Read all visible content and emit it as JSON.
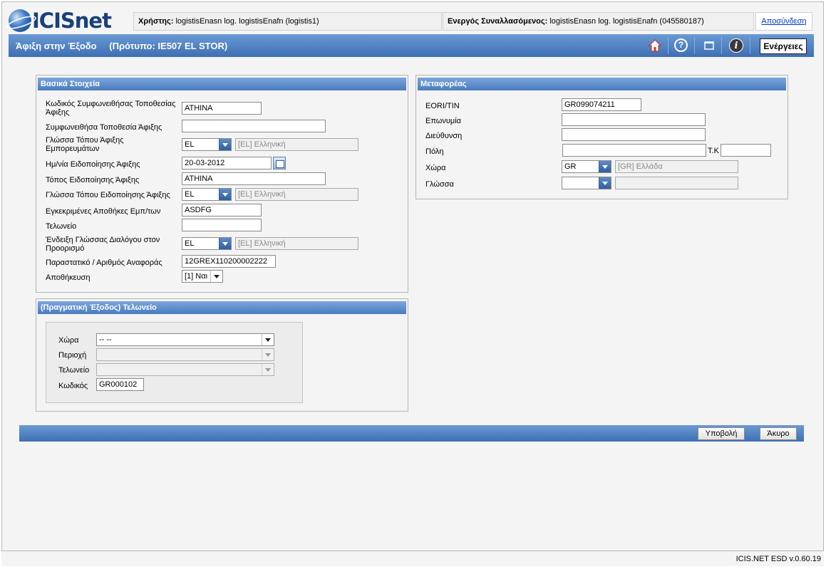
{
  "header": {
    "logo_text": "ICISnet",
    "user_label": "Χρήστης:",
    "user_value": "logistisEnasn log. logistisEnafn (logistis1)",
    "active_label": "Ενεργός Συναλλασόμενος:",
    "active_value": "logistisEnasn log. logistisEnafn (045580187)",
    "logout": "Αποσύνδεση"
  },
  "titlebar": {
    "title": "Άφιξη στην Έξοδο",
    "template": "(Πρότυπο: IE507 EL STOR)",
    "icons": [
      "home-icon",
      "help-icon",
      "window-icon",
      "info-icon"
    ],
    "actions_label": "Ενέργειες"
  },
  "basic": {
    "title": "Βασικά Στοιχεία",
    "agreed_code_label": "Κωδικός Συμφωνειθήσας Τοποθεσίας Άφιξης",
    "agreed_code_value": "ATHINA",
    "agreed_location_label": "Συμφωνειθήσα Τοποθεσία Άφιξης",
    "agreed_location_value": "",
    "goods_lang_label": "Γλώσσα Τόπου Άφιξης Εμπορευμάτων",
    "goods_lang_code": "EL",
    "goods_lang_desc": "[EL] Ελληνική",
    "notif_date_label": "Ημ/νία Ειδοποίησης Άφιξης",
    "notif_date_value": "20-03-2012",
    "notif_place_label": "Τόπος Ειδοποίησης Άφιξης",
    "notif_place_value": "ATHINA",
    "notif_lang_label": "Γλώσσα Τόπου Ειδοποίησης Άφιξης",
    "notif_lang_code": "EL",
    "notif_lang_desc": "[EL] Ελληνική",
    "warehouses_label": "Εγκεκριμένες Αποθήκες Εμπ/των",
    "warehouses_value": "ASDFG",
    "customs_label": "Τελωνείο",
    "customs_value": "",
    "dialog_lang_label": "Ένδειξη Γλώσσας Διαλόγου στον Προορισμό",
    "dialog_lang_code": "EL",
    "dialog_lang_desc": "[EL] Ελληνική",
    "ref_label": "Παραστατικό / Αριθμός Αναφοράς",
    "ref_value": "12GREX110200002222",
    "storage_label": "Αποθήκευση",
    "storage_value": "[1] Ναι"
  },
  "exit_office": {
    "title": "(Πραγματική Έξοδος) Τελωνείο",
    "country_label": "Χώρα",
    "country_value": "-- --",
    "region_label": "Περιοχή",
    "region_value": "",
    "customs_label": "Τελωνείο",
    "customs_value": "",
    "code_label": "Κωδικός",
    "code_value": "GR000102"
  },
  "carrier": {
    "title": "Μεταφορέας",
    "eori_label": "EORI/TIN",
    "eori_value": "GR099074211",
    "name_label": "Επωνυμία",
    "name_value": "",
    "address_label": "Διεύθυνση",
    "address_value": "",
    "city_label": "Πόλη",
    "city_value": "",
    "postcode_label": "Τ.Κ",
    "postcode_value": "",
    "country_label": "Χώρα",
    "country_code": "GR",
    "country_desc": "[GR] Ελλάδα",
    "language_label": "Γλώσσα",
    "language_code": "",
    "language_desc": ""
  },
  "buttons": {
    "submit": "Υποβολή",
    "cancel": "Άκυρο"
  },
  "footer": {
    "version": "ICIS.NET ESD v.0.60.19"
  },
  "colors": {
    "bar_blue": "#3e6fb4",
    "header_text": "#1a3f7a",
    "link": "#0033cc"
  }
}
